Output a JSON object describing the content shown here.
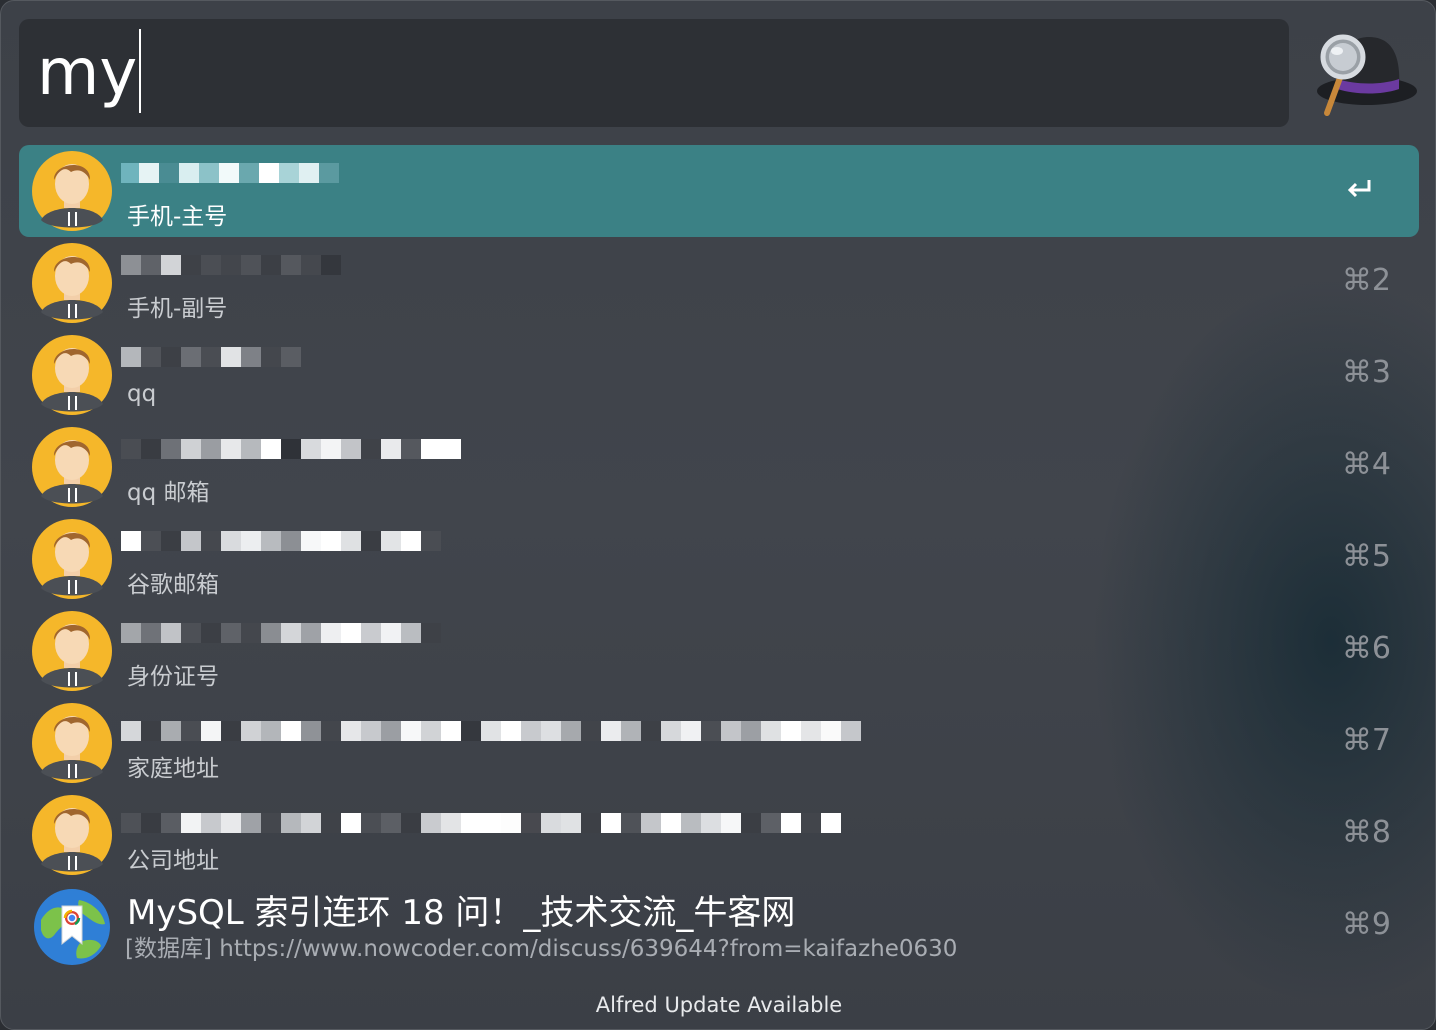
{
  "search": {
    "query": "my"
  },
  "results": [
    {
      "subtitle": "手机-主号",
      "shortcut": "",
      "selected": true
    },
    {
      "subtitle": "手机-副号",
      "shortcut": "⌘2"
    },
    {
      "subtitle": "qq",
      "shortcut": "⌘3"
    },
    {
      "subtitle": "qq 邮箱",
      "shortcut": "⌘4"
    },
    {
      "subtitle": "谷歌邮箱",
      "shortcut": "⌘5"
    },
    {
      "subtitle": "身份证号",
      "shortcut": "⌘6"
    },
    {
      "subtitle": "家庭地址",
      "shortcut": "⌘7"
    },
    {
      "subtitle": "公司地址",
      "shortcut": "⌘8"
    },
    {
      "title": "MySQL 索引连环 18 问！_技术交流_牛客网",
      "url": "[数据库] https://www.nowcoder.com/discuss/639644?from=kaifazhe0630",
      "shortcut": "⌘9"
    }
  ],
  "footer": {
    "text": "Alfred Update Available"
  },
  "icons": {
    "contact": "avatar-icon",
    "bookmark": "chrome-bookmark-icon",
    "logo": "alfred-hat-icon",
    "enter": "return-key-icon"
  },
  "colors": {
    "selected_row": "#3b8185",
    "window_bg": "#41454c",
    "search_bg": "#2d3035"
  }
}
